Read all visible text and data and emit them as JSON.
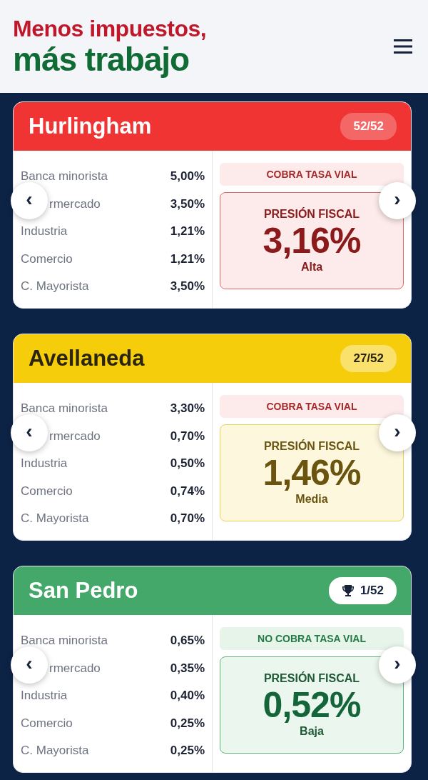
{
  "header": {
    "title_line_1": "Menos impuestos,",
    "title_line_2": "más trabajo"
  },
  "cards": [
    {
      "name": "Hurlingham",
      "kind": "high",
      "rank": "52/52",
      "trophy": false,
      "rates": [
        {
          "label": "Banca minorista",
          "value": "5,00%"
        },
        {
          "label": "rmercado",
          "value": "3,50%"
        },
        {
          "label": "Industria",
          "value": "1,21%"
        },
        {
          "label": "Comercio",
          "value": "1,21%"
        },
        {
          "label": "C. Mayorista",
          "value": "3,50%"
        }
      ],
      "road_fee": "COBRA TASA VIAL",
      "pressure_label": "PRESIÓN FISCAL",
      "pressure": "3,16%",
      "pressure_level": "Alta",
      "prev": "‹",
      "next": "›"
    },
    {
      "name": "Avellaneda",
      "kind": "medium",
      "rank": "27/52",
      "trophy": false,
      "rates": [
        {
          "label": "Banca minorista",
          "value": "3,30%"
        },
        {
          "label": "rmercado",
          "value": "0,70%"
        },
        {
          "label": "Industria",
          "value": "0,50%"
        },
        {
          "label": "Comercio",
          "value": "0,74%"
        },
        {
          "label": "C. Mayorista",
          "value": "0,70%"
        }
      ],
      "road_fee": "COBRA TASA VIAL",
      "pressure_label": "PRESIÓN FISCAL",
      "pressure": "1,46%",
      "pressure_level": "Media",
      "prev": "‹",
      "next": "›"
    },
    {
      "name": "San Pedro",
      "kind": "low",
      "rank": "1/52",
      "trophy": true,
      "rates": [
        {
          "label": "Banca minorista",
          "value": "0,65%"
        },
        {
          "label": "rmercado",
          "value": "0,35%"
        },
        {
          "label": "Industria",
          "value": "0,40%"
        },
        {
          "label": "Comercio",
          "value": "0,25%"
        },
        {
          "label": "C. Mayorista",
          "value": "0,25%"
        }
      ],
      "road_fee": "NO COBRA TASA VIAL",
      "pressure_label": "PRESIÓN FISCAL",
      "pressure": "0,52%",
      "pressure_level": "Baja",
      "prev": "‹",
      "next": "›"
    }
  ]
}
